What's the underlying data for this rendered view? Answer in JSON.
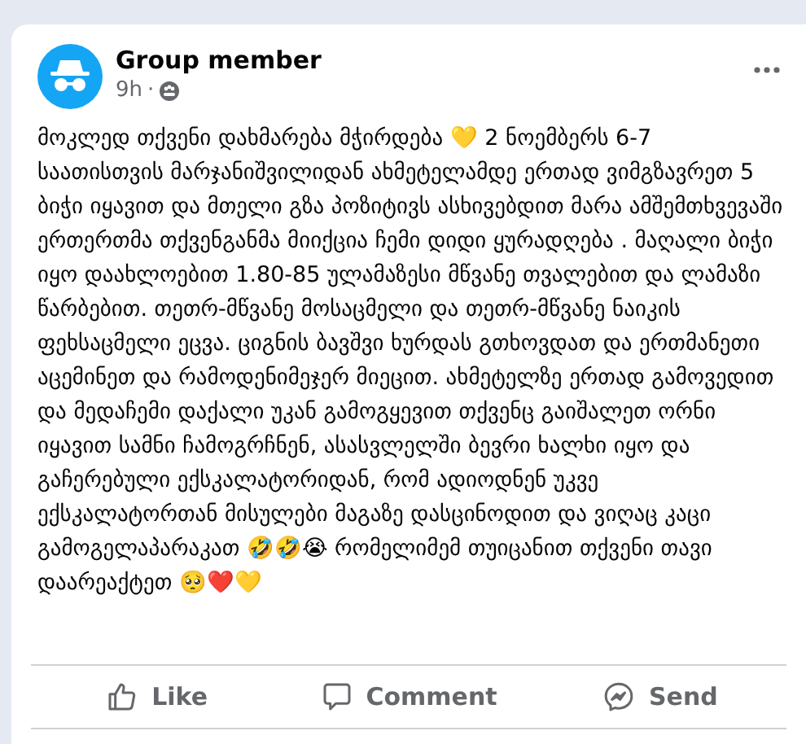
{
  "post": {
    "author": "Group member",
    "time": "9h",
    "separator": "·",
    "body": "მოკლედ თქვენი დახმარება მჭირდება 💛 2 ნოემბერს 6-7 საათისთვის მარჯანიშვილიდან ახმეტელამდე ერთად ვიმგზავრეთ 5 ბიჭი იყავით და მთელი გზა პოზიტივს ასხივებდით მარა ამშემთხვევაში ერთერთმა თქვენგანმა მიიქცია ჩემი დიდი ყურადღება . მაღალი ბიჭი იყო დაახლოებით 1.80-85 ულამაზესი მწვანე თვალებით და ლამაზი წარბებით. თეთრ-მწვანე მოსაცმელი და თეთრ-მწვანე ნაიკის ფეხსაცმელი ეცვა. ციგნის ბავშვი ხურდას გთხოვდათ და ერთმანეთი აცემინეთ და რამოდენიმეჯერ მიეცით. ახმეტელზე ერთად გამოვედით და მედაჩემი დაქალი უკან გამოგყევით თქვენც გაიშალეთ ორნი იყავით სამნი ჩამოგრჩნენ, ასასვლელში ბევრი ხალხი იყო და გაჩერებული ექსკალატორიდან, რომ ადიოდნენ უკვე ექსკალატორთან მისულები მაგაზე დასცინოდით და ვიღაც კაცი გამოგელაპარაკათ 🤣🤣😭 რომელიმემ თუიცანით თქვენი თავი დაარეაქტეთ 🥺❤️💛"
  },
  "actions": [
    {
      "kind": "like",
      "label": "Like"
    },
    {
      "kind": "comment",
      "label": "Comment"
    },
    {
      "kind": "send",
      "label": "Send"
    }
  ]
}
